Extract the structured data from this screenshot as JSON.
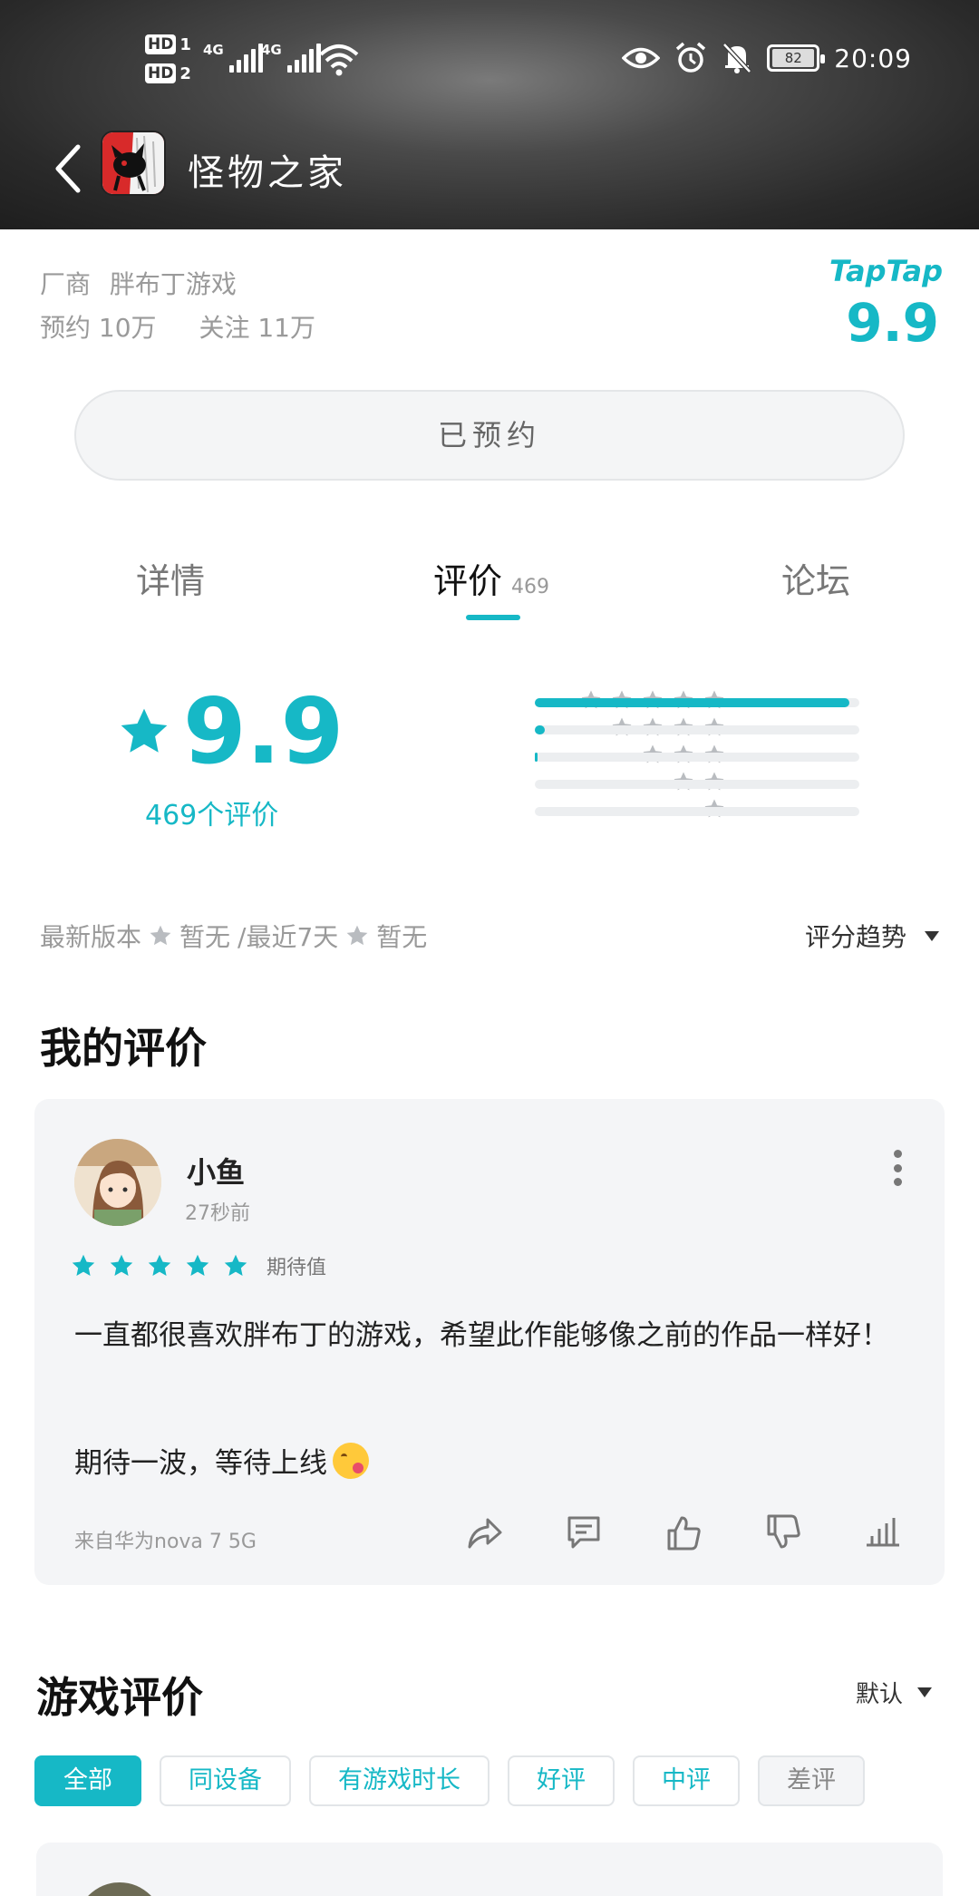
{
  "status_bar": {
    "hd1": "HD",
    "hd1_num": "1",
    "hd2": "HD",
    "hd2_num": "2",
    "net1": "4G",
    "net2": "4G",
    "battery": "82",
    "time": "20:09"
  },
  "title_bar": {
    "title": "怪物之家"
  },
  "info": {
    "maker_label": "厂商",
    "maker": "胖布丁游戏",
    "reservations": "预约 10万",
    "follows": "关注 11万",
    "taptap_brand": "TapTap",
    "taptap_score": "9.9"
  },
  "reserve_button": "已预约",
  "tabs": {
    "detail": "详情",
    "review": "评价",
    "review_count": "469",
    "forum": "论坛"
  },
  "rating": {
    "score": "9.9",
    "count_label": "469个评价",
    "distribution": [
      {
        "stars": 5,
        "fraction": 0.97
      },
      {
        "stars": 4,
        "fraction": 0.03
      },
      {
        "stars": 3,
        "fraction": 0.005
      },
      {
        "stars": 2,
        "fraction": 0.0
      },
      {
        "stars": 1,
        "fraction": 0.0
      }
    ],
    "latest_version_label": "最新版本",
    "latest_version_value": "暂无",
    "recent_label": "/最近7天",
    "recent_value": "暂无",
    "trend_label": "评分趋势"
  },
  "my_review": {
    "section_title": "我的评价",
    "username": "小鱼",
    "time": "27秒前",
    "stars": 5,
    "star_tag": "期待值",
    "text1": "一直都很喜欢胖布丁的游戏，希望此作能够像之前的作品一样好！",
    "text2": "期待一波，等待上线",
    "device": "来自华为nova 7 5G"
  },
  "game_reviews": {
    "section_title": "游戏评价",
    "sort": "默认",
    "filters": [
      "全部",
      "同设备",
      "有游戏时长",
      "好评",
      "中评",
      "差评"
    ]
  },
  "colors": {
    "accent": "#16b8c6",
    "star_gray": "#b9bcc0"
  }
}
